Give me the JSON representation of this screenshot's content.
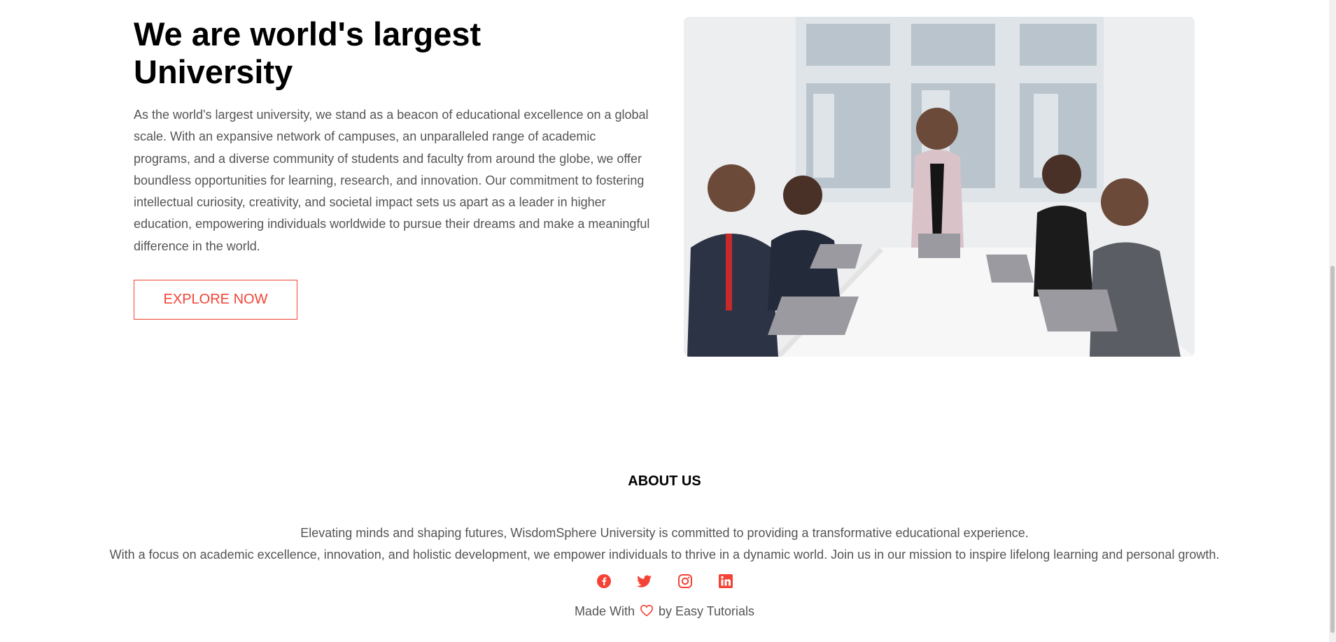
{
  "hero": {
    "title": "We are world's largest University",
    "text": "As the world's largest university, we stand as a beacon of educational excellence on a global scale. With an expansive network of campuses, an unparalleled range of academic programs, and a diverse community of students and faculty from around the globe, we offer boundless opportunities for learning, research, and innovation. Our commitment to fostering intellectual curiosity, creativity, and societal impact sets us apart as a leader in higher education, empowering individuals worldwide to pursue their dreams and make a meaningful difference in the world.",
    "button_label": "EXPLORE NOW"
  },
  "about": {
    "title": "ABOUT US",
    "line1": "Elevating minds and shaping futures, WisdomSphere University is committed to providing a transformative educational experience.",
    "line2": "With a focus on academic excellence, innovation, and holistic development, we empower individuals to thrive in a dynamic world. Join us in our mission to inspire lifelong learning and personal growth."
  },
  "social_icons": [
    "facebook-icon",
    "twitter-icon",
    "instagram-icon",
    "linkedin-icon"
  ],
  "footer": {
    "made_with": "Made With",
    "by_text": "by Easy Tutorials"
  },
  "colors": {
    "accent": "#f44336",
    "text": "#555555",
    "heading": "#000000"
  }
}
